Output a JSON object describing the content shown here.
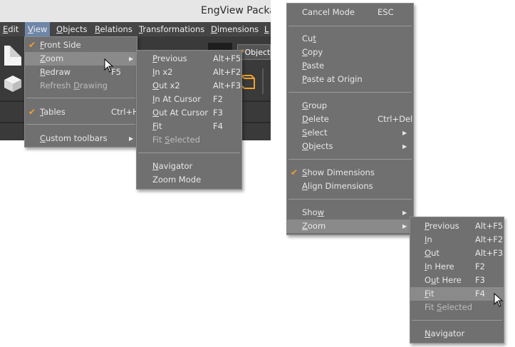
{
  "window": {
    "title": "EngView Packa"
  },
  "menubar": [
    {
      "label": "Edit",
      "key": "E",
      "rest": "dit"
    },
    {
      "label": "View",
      "key": "V",
      "rest": "iew"
    },
    {
      "label": "Objects",
      "key": "O",
      "rest": "bjects"
    },
    {
      "label": "Relations",
      "key": "R",
      "rest": "elations"
    },
    {
      "label": "Transformations",
      "key": "T",
      "rest": "ransformations"
    },
    {
      "label": "Dimensions",
      "key": "D",
      "rest": "imensions"
    },
    {
      "label": "L",
      "key": "L",
      "rest": ""
    }
  ],
  "toolbar": {
    "object_tab": "Objects"
  },
  "view_menu": {
    "front_side": {
      "key": "F",
      "rest": "ront Side"
    },
    "zoom": {
      "key": "Z",
      "rest": "oom"
    },
    "redraw": {
      "key": "R",
      "rest": "edraw",
      "shortcut": "F5"
    },
    "refresh": {
      "pre": "Refresh ",
      "key": "D",
      "rest": "rawing"
    },
    "tables": {
      "key": "T",
      "rest": "ables",
      "shortcut": "Ctrl+H"
    },
    "custom_toolbars": {
      "key": "C",
      "rest": "ustom toolbars"
    }
  },
  "zoom_left": [
    {
      "key": "P",
      "rest": "revious",
      "shortcut": "Alt+F5"
    },
    {
      "key": "I",
      "rest": "n x2",
      "shortcut": "Alt+F2"
    },
    {
      "key": "O",
      "rest": "ut x2",
      "shortcut": "Alt+F3"
    },
    {
      "key": "I",
      "rest": "n At Cursor",
      "shortcut": "F2"
    },
    {
      "key": "O",
      "rest": "ut At Cursor",
      "shortcut": "F3"
    },
    {
      "key": "F",
      "rest": "it",
      "shortcut": "F4"
    },
    {
      "pre": "Fit ",
      "key": "S",
      "rest": "elected",
      "shortcut": ""
    },
    {
      "key": "N",
      "rest": "avigator",
      "shortcut": ""
    },
    {
      "pre": "Zoom Mode",
      "key": "",
      "rest": "",
      "shortcut": ""
    }
  ],
  "context_menu": {
    "cancel_mode": {
      "label": "Cancel Mode",
      "shortcut": "ESC"
    },
    "cut": {
      "pre": "Cu",
      "key": "t"
    },
    "copy": {
      "key": "C",
      "rest": "opy"
    },
    "paste": {
      "key": "P",
      "rest": "aste"
    },
    "paste_origin": {
      "key": "P",
      "rest": "aste at Origin"
    },
    "group": {
      "key": "G",
      "rest": "roup"
    },
    "delete": {
      "key": "D",
      "rest": "elete",
      "shortcut": "Ctrl+Del"
    },
    "select": {
      "key": "S",
      "rest": "elect"
    },
    "objects": {
      "key": "O",
      "rest": "bjects"
    },
    "show_dimensions": {
      "key": "S",
      "rest": "how Dimensions"
    },
    "align_dimensions": {
      "key": "A",
      "rest": "lign Dimensions"
    },
    "show": {
      "pre": "Sho",
      "key": "w"
    },
    "zoom": {
      "key": "Z",
      "rest": "oom"
    }
  },
  "zoom_right": [
    {
      "key": "P",
      "rest": "revious",
      "shortcut": "Alt+F5"
    },
    {
      "key": "I",
      "rest": "n",
      "shortcut": "Alt+F2"
    },
    {
      "key": "O",
      "rest": "ut",
      "shortcut": "Alt+F3"
    },
    {
      "key": "I",
      "rest": "n Here",
      "shortcut": "F2"
    },
    {
      "pre": "O",
      "key": "u",
      "rest": "t Here",
      "shortcut": "F3"
    },
    {
      "key": "F",
      "rest": "it",
      "shortcut": "F4"
    },
    {
      "pre": "Fit ",
      "key": "S",
      "rest": "elected",
      "shortcut": ""
    },
    {
      "key": "N",
      "rest": "avigator",
      "shortcut": ""
    }
  ],
  "colors": {
    "menu_bg": "#707070",
    "highlight": "#8a8a8a",
    "check": "#f0a030",
    "active_menu": "#6e86a8"
  },
  "icons": [
    "check-icon",
    "submenu-arrow-icon",
    "mouse-cursor-icon",
    "document-icon",
    "box-icon"
  ]
}
